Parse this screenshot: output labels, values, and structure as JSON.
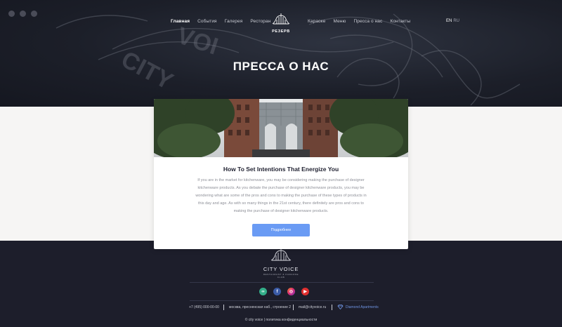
{
  "nav": {
    "left": [
      "Главная",
      "События",
      "Галерея",
      "Ресторан"
    ],
    "right": [
      "Караоке",
      "Меню",
      "Пресса о нас",
      "Контакты"
    ],
    "logo_text": "РЕЗЕРВ",
    "lang_en": "EN",
    "lang_ru": "RU"
  },
  "hero": {
    "title": "ПРЕССА О НАС"
  },
  "article": {
    "title": "How To Set Intentions That Energize You",
    "body": "If you are in the market for kitchenware, you may be considering making the purchase of designer kitchenware products. As you debate the purchase of designer kitchenware products, you may be wondering what are some of the pros and cons to making the purchase of these types of products in this day and age. As with so many things in the 21st century, there definitely are pros and cons to making the purchase of designer kitchenware products.",
    "button": "Подробнее"
  },
  "footer": {
    "brand": "CITY VOICE",
    "brand_sub": "RESTAURANT & KARAOKE CLUB",
    "socials": [
      "tripadvisor-icon",
      "facebook-icon",
      "instagram-icon",
      "youtube-icon"
    ],
    "phone": "+7 (495) 000-00-00",
    "address": "москва, пресненская наб., строение 2",
    "email": "mail@cityvoice.ru",
    "partner": "Diamond Apartments",
    "copyright": "© city voice | политика конфиденциальности"
  },
  "colors": {
    "accent": "#6a9bf4",
    "footer_bg": "#1d1e2b",
    "partner": "#6e93e0"
  }
}
